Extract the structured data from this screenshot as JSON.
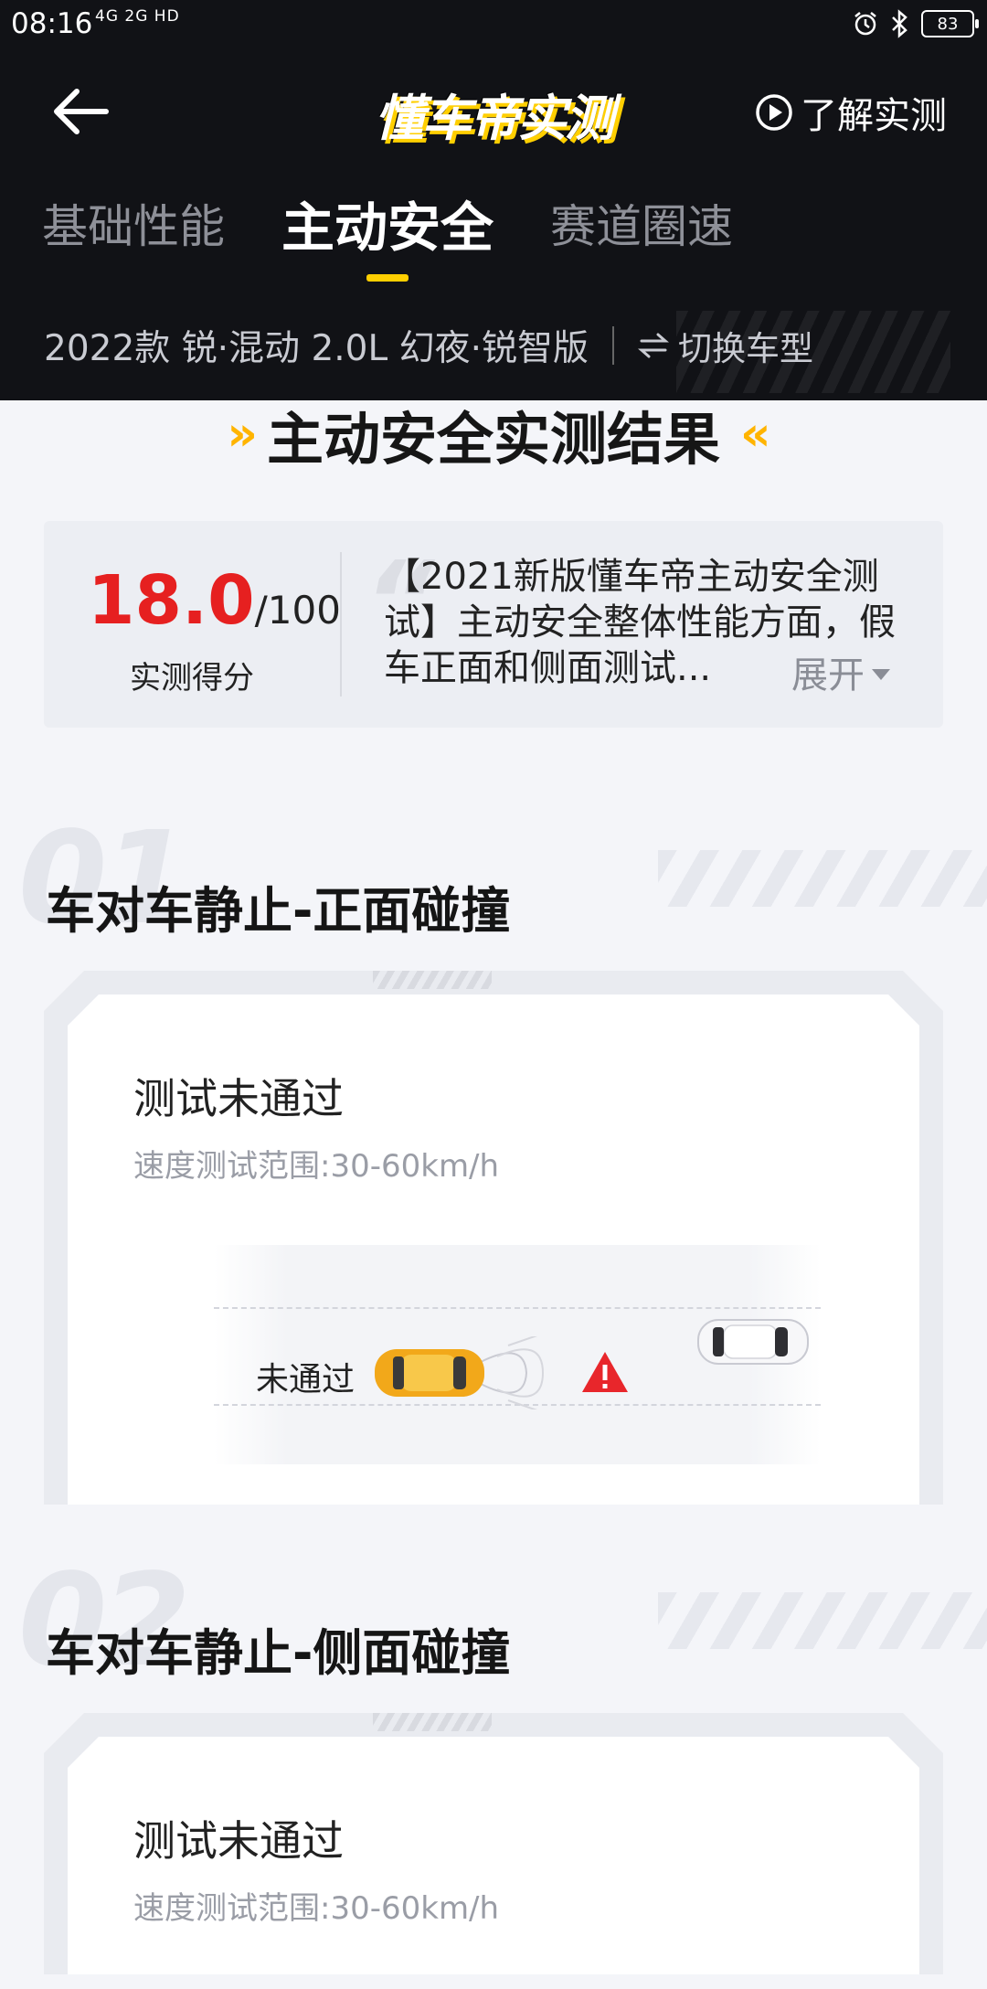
{
  "status_bar": {
    "time": "08:16",
    "network": "4G 2G HD",
    "battery": "83"
  },
  "header": {
    "brand": "懂车帝实测",
    "learn_label": "了解实测",
    "tabs": [
      "基础性能",
      "主动安全",
      "赛道圈速"
    ],
    "active_tab": "主动安全",
    "model": "2022款 锐·混动 2.0L 幻夜·锐智版",
    "switch_label": "切换车型",
    "accent_color": "#ffcf00"
  },
  "result": {
    "title": "主动安全实测结果",
    "score": "18.0",
    "score_max": "/100",
    "score_label": "实测得分",
    "summary": "【2021新版懂车帝主动安全测试】主动安全整体性能方面，假车正面和侧面测试...",
    "expand_label": "展开"
  },
  "tests": [
    {
      "number": "01",
      "title": "车对车静止-正面碰撞",
      "status": "测试未通过",
      "range": "速度测试范围:30-60km/h",
      "scene_label": "未通过"
    },
    {
      "number": "02",
      "title": "车对车静止-侧面碰撞",
      "status": "测试未通过",
      "range": "速度测试范围:30-60km/h"
    }
  ]
}
